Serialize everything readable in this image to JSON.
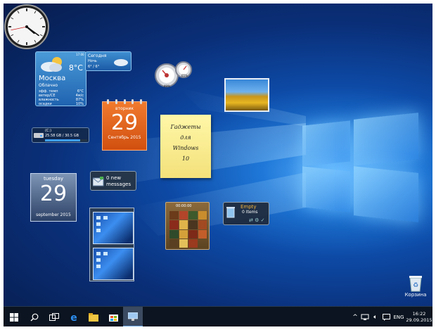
{
  "weather": {
    "temp": "8°C",
    "city": "Москва",
    "condition": "Облачно",
    "rows": [
      {
        "label": "эфф. темп",
        "value": "6°C"
      },
      {
        "label": "ветер/СЕ",
        "value": "4м/с"
      },
      {
        "label": "влажность",
        "value": "87%"
      },
      {
        "label": "осадки",
        "value": "10%"
      }
    ],
    "top_time": "17:00",
    "today_label": "Сегодня",
    "night_label": "Ночь",
    "today_temps": "6° / 6°"
  },
  "calendar_ru": {
    "weekday": "вторник",
    "day": "29",
    "month_year": "Сентябрь 2015"
  },
  "drive": {
    "label": "(C:)",
    "space": "25.58 GB / 30.5 GB",
    "used_fraction": 0.84
  },
  "sticky_note": {
    "lines": [
      "Гаджеты",
      "для",
      "Windows",
      "10"
    ]
  },
  "gauges": {
    "cpu": "49%",
    "mem": "65%"
  },
  "calendar_en": {
    "weekday": "tuesday",
    "day": "29",
    "month_year": "september 2015"
  },
  "mail": {
    "count": "0 new",
    "label": "messages"
  },
  "puzzle": {
    "timer": "00:00:00"
  },
  "recycle_gadget": {
    "status": "Empty",
    "items": "0 Items"
  },
  "desktop_bin": {
    "label": "Корзина"
  },
  "taskbar": {
    "language": "ENG",
    "time": "16:22",
    "date": "29.09.2015",
    "icons": [
      "windows-start-icon",
      "search-icon",
      "task-view-icon",
      "edge-icon",
      "explorer-icon",
      "store-icon",
      "active-app-icon"
    ]
  },
  "colors": {
    "accent_orange": "#d9531a",
    "desktop_blue": "#0d4aa6",
    "taskbar": "#0b1420"
  },
  "clock": {
    "hour": 4,
    "minute": 21,
    "second": 43
  }
}
